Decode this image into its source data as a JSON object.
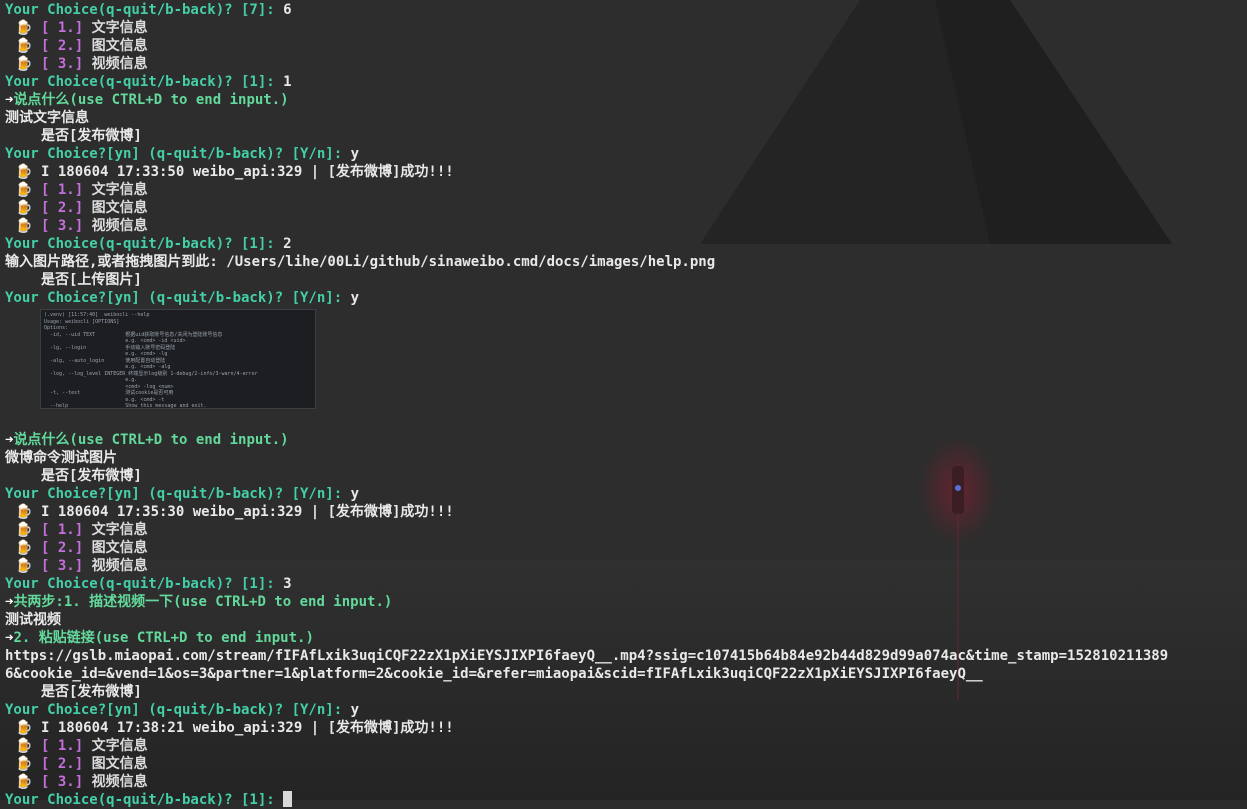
{
  "terminal": {
    "lines": [
      {
        "type": "prompt",
        "text": "Your Choice(q-quit/b-back)? [7]: ",
        "answer": "6"
      },
      {
        "type": "menu",
        "num": "[ 1.]",
        "label": "文字信息"
      },
      {
        "type": "menu",
        "num": "[ 2.]",
        "label": "图文信息"
      },
      {
        "type": "menu",
        "num": "[ 3.]",
        "label": "视频信息"
      },
      {
        "type": "prompt",
        "text": "Your Choice(q-quit/b-back)? [1]: ",
        "answer": "1"
      },
      {
        "type": "arrow",
        "text": "说点什么(use CTRL+D to end input.)"
      },
      {
        "type": "plain",
        "text": "测试文字信息"
      },
      {
        "type": "indent",
        "text": "是否[发布微博]"
      },
      {
        "type": "prompt",
        "text": "Your Choice?[yn] (q-quit/b-back)? [Y/n]: ",
        "answer": "y"
      },
      {
        "type": "log",
        "text": "I 180604 17:33:50 weibo_api:329 | [发布微博]成功!!!"
      },
      {
        "type": "menu",
        "num": "[ 1.]",
        "label": "文字信息"
      },
      {
        "type": "menu",
        "num": "[ 2.]",
        "label": "图文信息"
      },
      {
        "type": "menu",
        "num": "[ 3.]",
        "label": "视频信息"
      },
      {
        "type": "prompt",
        "text": "Your Choice(q-quit/b-back)? [1]: ",
        "answer": "2"
      },
      {
        "type": "plain",
        "text": "输入图片路径,或者拖拽图片到此: /Users/lihe/00Li/github/sinaweibo.cmd/docs/images/help.png"
      },
      {
        "type": "indent",
        "text": "是否[上传图片]"
      },
      {
        "type": "prompt",
        "text": "Your Choice?[yn] (q-quit/b-back)? [Y/n]: ",
        "answer": "y"
      },
      {
        "type": "image"
      },
      {
        "type": "arrow",
        "text": "说点什么(use CTRL+D to end input.)"
      },
      {
        "type": "plain",
        "text": "微博命令测试图片"
      },
      {
        "type": "indent",
        "text": "是否[发布微博]"
      },
      {
        "type": "prompt",
        "text": "Your Choice?[yn] (q-quit/b-back)? [Y/n]: ",
        "answer": "y"
      },
      {
        "type": "log",
        "text": "I 180604 17:35:30 weibo_api:329 | [发布微博]成功!!!"
      },
      {
        "type": "menu",
        "num": "[ 1.]",
        "label": "文字信息"
      },
      {
        "type": "menu",
        "num": "[ 2.]",
        "label": "图文信息"
      },
      {
        "type": "menu",
        "num": "[ 3.]",
        "label": "视频信息"
      },
      {
        "type": "prompt",
        "text": "Your Choice(q-quit/b-back)? [1]: ",
        "answer": "3"
      },
      {
        "type": "arrow",
        "text": "共两步:1. 描述视频一下(use CTRL+D to end input.)"
      },
      {
        "type": "plain",
        "text": "测试视频"
      },
      {
        "type": "arrow",
        "text": "2. 粘贴链接(use CTRL+D to end input.)"
      },
      {
        "type": "plain",
        "text": "https://gslb.miaopai.com/stream/fIFAfLxik3uqiCQF22zX1pXiEYSJIXPI6faeyQ__.mp4?ssig=c107415b64b84e92b44d829d99a074ac&time_stamp=152810211389"
      },
      {
        "type": "plain",
        "text": "6&cookie_id=&vend=1&os=3&partner=1&platform=2&cookie_id=&refer=miaopai&scid=fIFAfLxik3uqiCQF22zX1pXiEYSJIXPI6faeyQ__"
      },
      {
        "type": "indent",
        "text": "是否[发布微博]"
      },
      {
        "type": "prompt",
        "text": "Your Choice?[yn] (q-quit/b-back)? [Y/n]: ",
        "answer": "y"
      },
      {
        "type": "log",
        "text": "I 180604 17:38:21 weibo_api:329 | [发布微博]成功!!!"
      },
      {
        "type": "menu",
        "num": "[ 1.]",
        "label": "文字信息"
      },
      {
        "type": "menu",
        "num": "[ 2.]",
        "label": "图文信息"
      },
      {
        "type": "menu",
        "num": "[ 3.]",
        "label": "视频信息"
      },
      {
        "type": "prompt-cursor",
        "text": "Your Choice(q-quit/b-back)? [1]: ",
        "answer": ""
      }
    ],
    "icons": {
      "beer": "🍺",
      "arrow": "➜"
    }
  },
  "thumbnail": {
    "lines": [
      "(.venv) [11:57:40]  weibocli --help",
      "Usage: weibocli [OPTIONS]",
      "",
      "Options:",
      "  -id, --uid TEXT          根据uid获取账号信息/关闭为登陆账号信息",
      "                           e.g. <cmd> -id <uid>",
      "  -lg, --login             手动输入账号密码登陆",
      "                           e.g. <cmd> -lg",
      "  -alg, --auto_login       使用配置自动登陆",
      "                           e.g. <cmd> -alg",
      "  -log, --log_level INTEGER 终端显示log级别 1-debug/2-info/3-warn/4-error",
      "                           e.g.",
      "                           <cmd> -log <num>",
      "  -t, --test               测试cookie是否可用",
      "                           e.g. <cmd> -t",
      "  --help                   Show this message and exit.",
      "(.venv) [11:57:40]"
    ]
  },
  "colors": {
    "prompt": "#44cfa8",
    "menu_number": "#c56fdb",
    "arrow_text": "#63d99c",
    "background": "#2b2c2b"
  }
}
